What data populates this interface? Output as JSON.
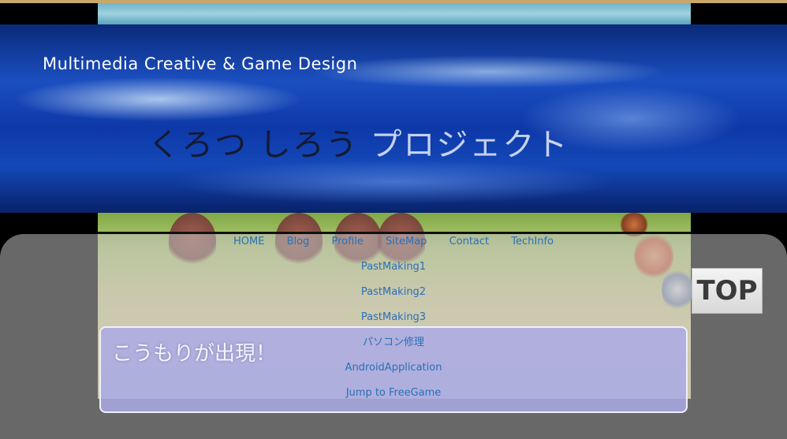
{
  "banner": {
    "subtitle": "Multimedia Creative & Game Design",
    "title_dark": "くろつ しろう",
    "title_light": "プロジェクト"
  },
  "nav": {
    "row": [
      "HOME",
      "Blog",
      "Profile",
      "SiteMap",
      "Contact",
      "TechInfo"
    ],
    "stack": [
      "PastMaking1",
      "PastMaking2",
      "PastMaking3",
      "パソコン修理",
      "AndroidApplication",
      "Jump to FreeGame"
    ]
  },
  "game": {
    "message": "こうもりが出現！"
  },
  "top_button": {
    "label": "TOP"
  },
  "colors": {
    "nav_link": "#2a6fb8",
    "top_strip": "#c8a86a"
  }
}
